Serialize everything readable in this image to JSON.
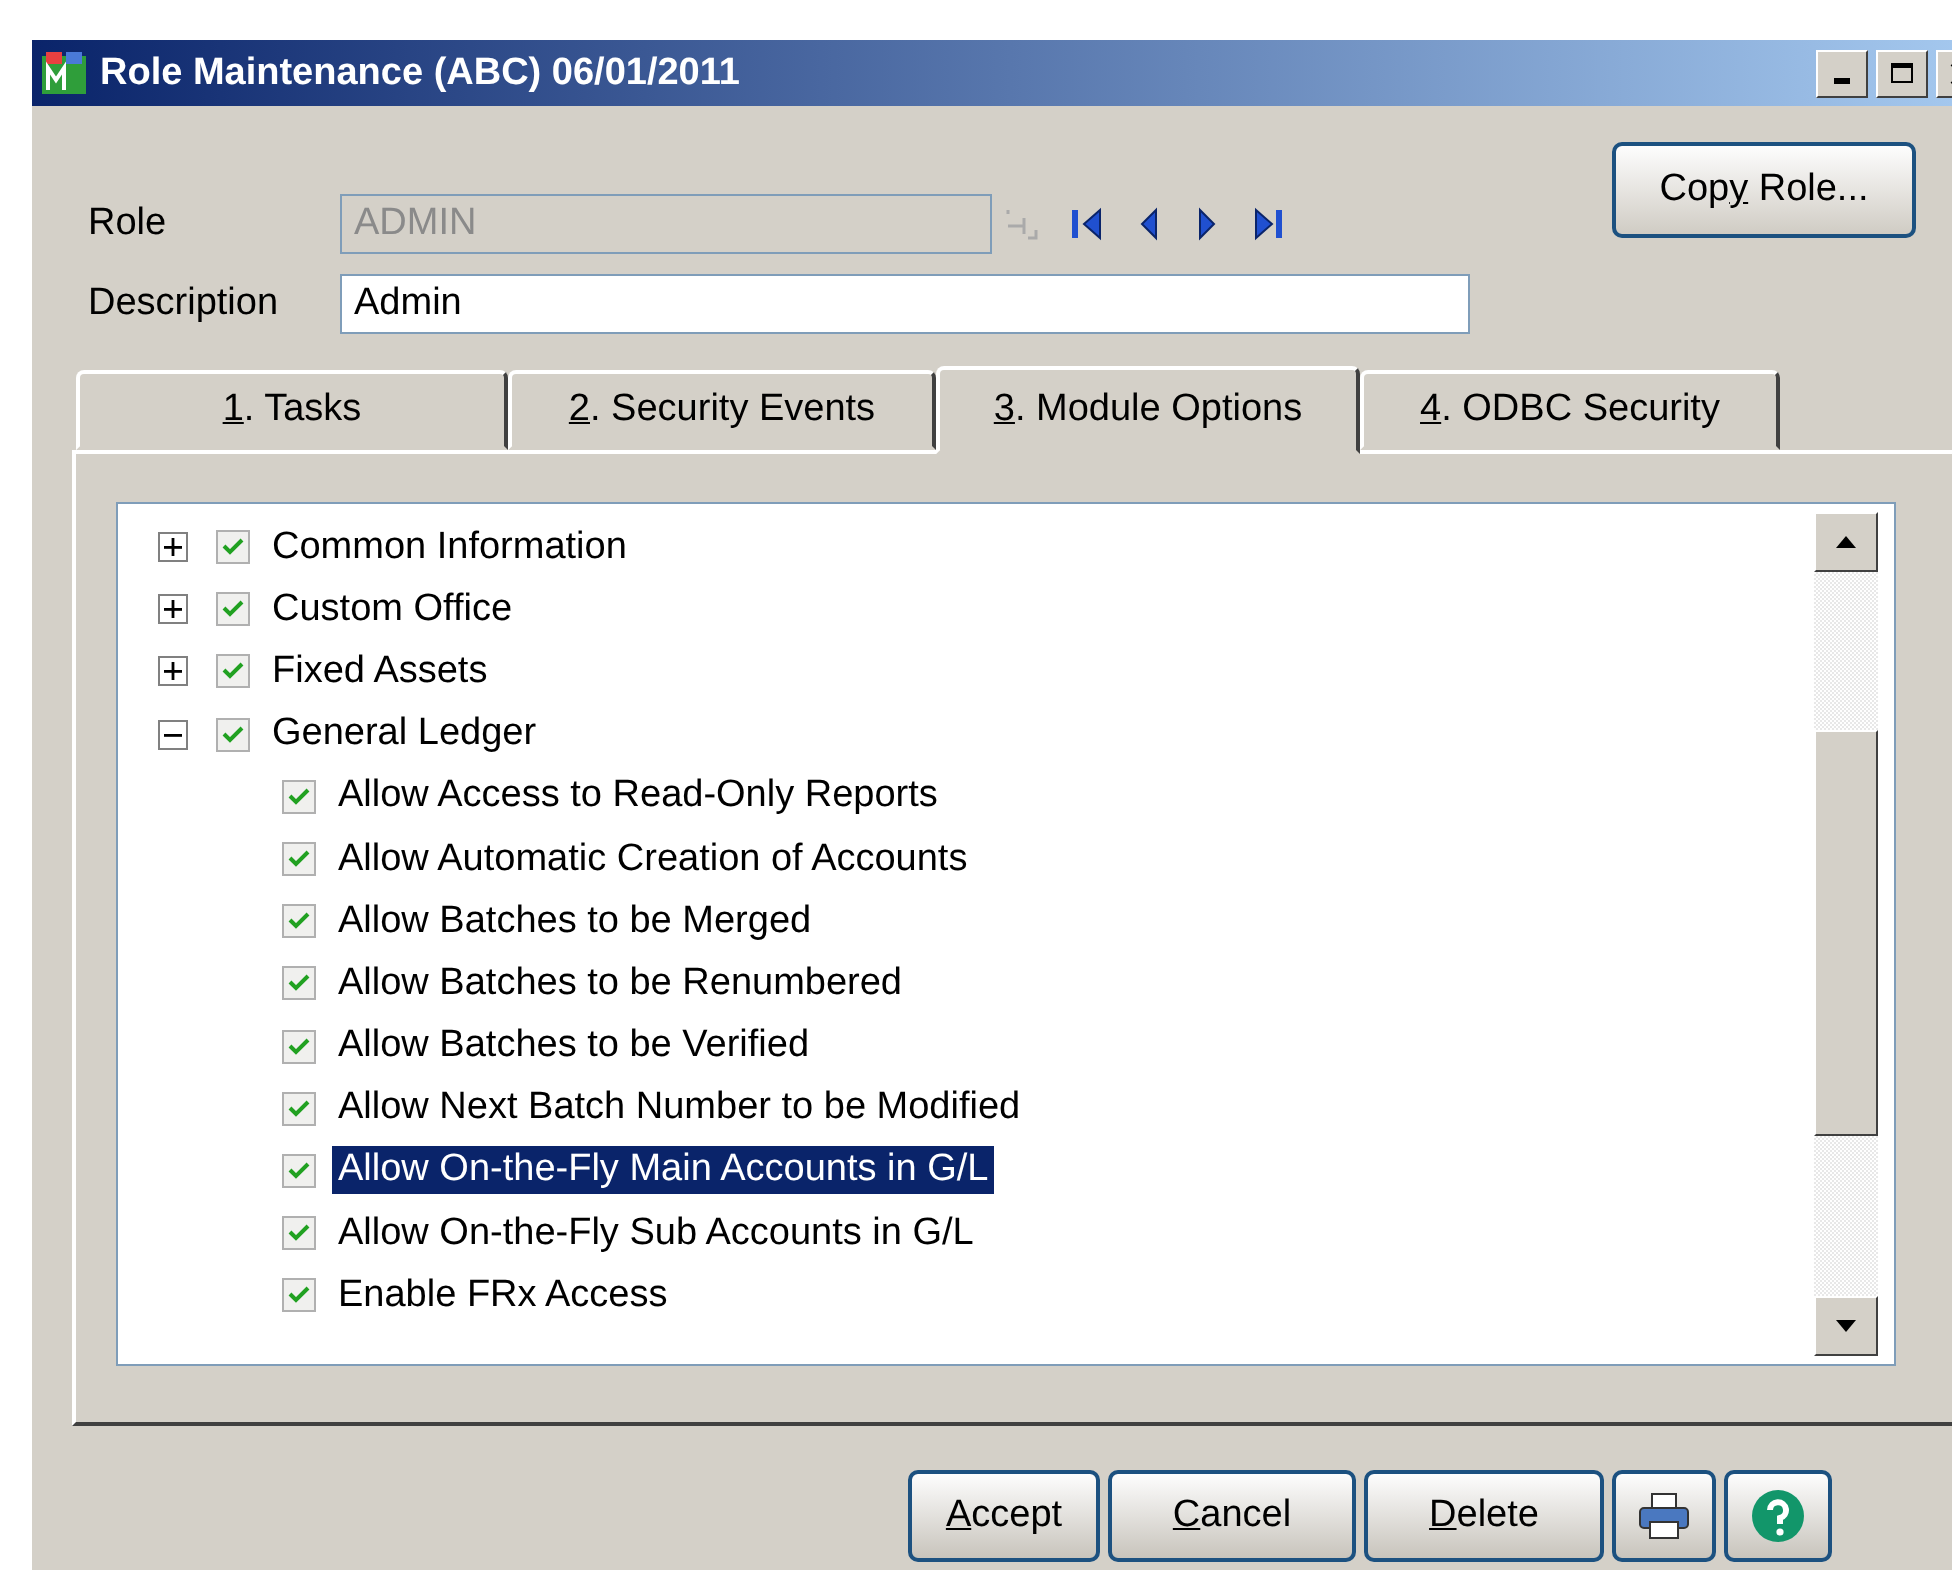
{
  "window": {
    "title": "Role Maintenance (ABC) 06/01/2011"
  },
  "form": {
    "role_label": "Role",
    "role_value": "ADMIN",
    "description_label": "Description",
    "description_value": "Admin",
    "copy_button": {
      "before": "Cop",
      "key": "y",
      "after": " Role..."
    }
  },
  "tabs": [
    {
      "key": "1",
      "after": ". Tasks",
      "selected": false
    },
    {
      "key": "2",
      "after": ". Security Events",
      "selected": false
    },
    {
      "key": "3",
      "after": ". Module Options",
      "selected": true
    },
    {
      "key": "4",
      "after": ". ODBC Security",
      "selected": false
    }
  ],
  "tree": [
    {
      "label": "Common Information",
      "checked": true,
      "expanded": false,
      "selected": false
    },
    {
      "label": "Custom Office",
      "checked": true,
      "expanded": false,
      "selected": false
    },
    {
      "label": "Fixed Assets",
      "checked": true,
      "expanded": false,
      "selected": false
    },
    {
      "label": "General Ledger",
      "checked": true,
      "expanded": true,
      "selected": false,
      "children": [
        {
          "label": "Allow Access to Read-Only Reports",
          "checked": true,
          "selected": false
        },
        {
          "label": "Allow Automatic Creation of Accounts",
          "checked": true,
          "selected": false
        },
        {
          "label": "Allow Batches to be Merged",
          "checked": true,
          "selected": false
        },
        {
          "label": "Allow Batches to be Renumbered",
          "checked": true,
          "selected": false
        },
        {
          "label": "Allow Batches to be Verified",
          "checked": true,
          "selected": false
        },
        {
          "label": "Allow Next Batch Number to be Modified",
          "checked": true,
          "selected": false
        },
        {
          "label": "Allow On-the-Fly Main Accounts in G/L",
          "checked": true,
          "selected": true
        },
        {
          "label": "Allow On-the-Fly Sub Accounts in G/L",
          "checked": true,
          "selected": false
        },
        {
          "label": "Enable FRx Access",
          "checked": true,
          "selected": false
        }
      ]
    }
  ],
  "buttons": [
    {
      "key": "A",
      "after": "ccept"
    },
    {
      "key": "C",
      "after": "ancel"
    },
    {
      "key": "D",
      "after": "elete"
    }
  ]
}
